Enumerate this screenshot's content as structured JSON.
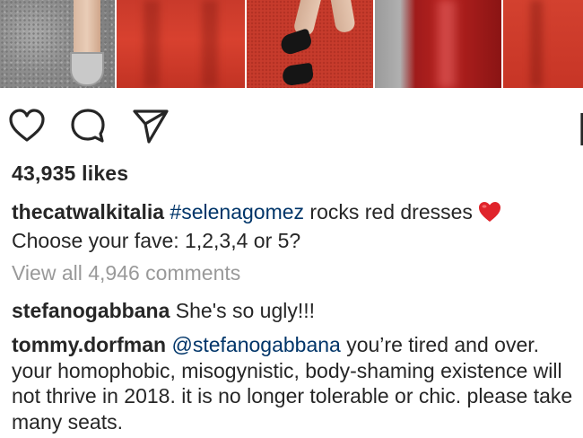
{
  "post": {
    "photo_description_icons": [
      "heart-icon",
      "comment-icon",
      "share-icon",
      "bookmark-icon"
    ],
    "likes_text": "43,935 likes",
    "caption": {
      "username": "thecatwalkitalia",
      "hashtag": "#selenagomez",
      "text_after_tag": " rocks red dresses",
      "emoji": "red-heart-emoji",
      "line2": "Choose your fave: 1,2,3,4 or 5?"
    },
    "view_all_comments": "View all 4,946 comments",
    "comments": [
      {
        "username": "stefanogabbana",
        "text": "She's so ugly!!!"
      },
      {
        "username": "tommy.dorfman",
        "mention": "@stefanogabbana",
        "text": " you’re tired and over. your homophobic, misogynistic, body-shaming existence will not thrive in 2018. it is no longer tolerable or chic. please take many seats."
      }
    ]
  },
  "colors": {
    "text": "#262626",
    "link": "#003569",
    "muted": "#999999",
    "emoji_red": "#e0242b"
  }
}
